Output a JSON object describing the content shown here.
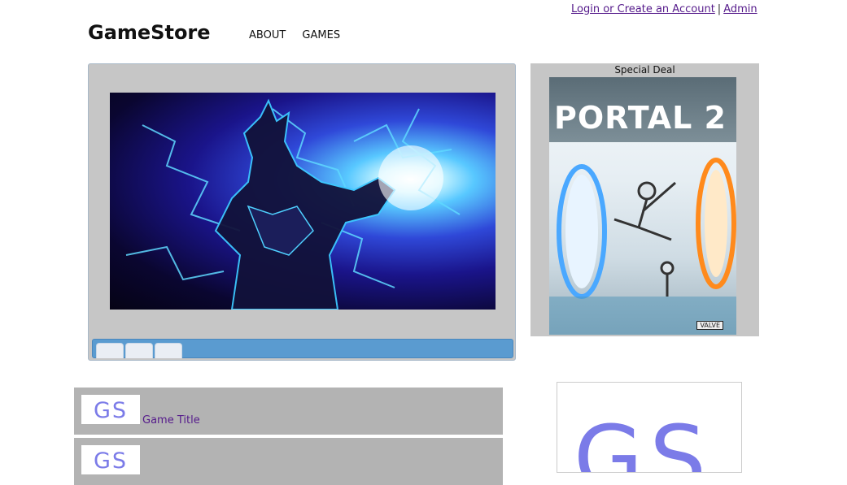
{
  "header": {
    "brand": "GameStore",
    "login_link": "Login or Create an Account",
    "separator": "|",
    "admin_link": "Admin",
    "nav": [
      {
        "label": "ABOUT"
      },
      {
        "label": "GAMES"
      }
    ]
  },
  "slider": {
    "tab_count": 3
  },
  "special_deal": {
    "title": "Special Deal",
    "cover_title": "PORTAL 2",
    "cover_publisher": "VALVE"
  },
  "games": [
    {
      "logo": "GS",
      "title": "Game Title"
    },
    {
      "logo": "GS",
      "title": ""
    }
  ],
  "side_logo": "GS",
  "colors": {
    "link": "#551a8b",
    "panel": "#c6c6c6",
    "slider_bar": "#5a9bd0",
    "list_row": "#b3b3b3",
    "logo": "#7b7be8"
  }
}
